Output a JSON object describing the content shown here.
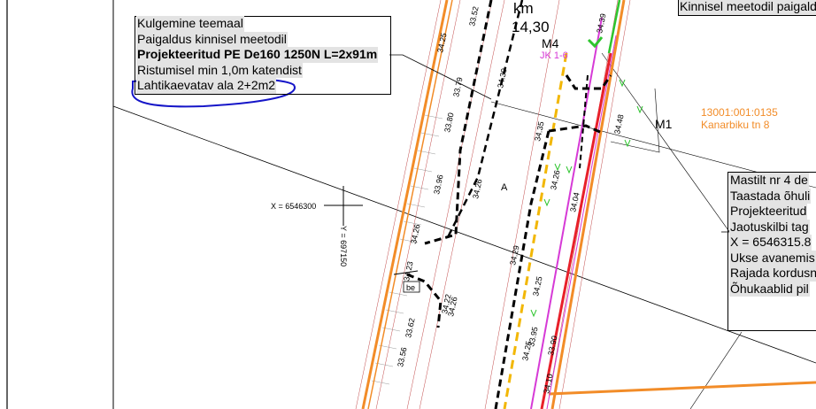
{
  "plan": {
    "top_right_note": "Kinnisel meetodil paigaldus",
    "km_label": "km",
    "km_value": "14,30",
    "station_m4": "M4",
    "station_m1": "M1",
    "jk_label": "JK 1-6",
    "parcel": {
      "id": "13001:001:0135",
      "address": "Kanarbiku tn 8"
    },
    "coord_x": "X = 6546300",
    "coord_y": "Y = 697150",
    "road_letter": "A",
    "building_label": "be",
    "elevations": [
      "33.52",
      "34.25",
      "33.79",
      "34.30",
      "33.80",
      "33.96",
      "34.26",
      "34.26",
      "34.23",
      "33.62",
      "34.22",
      "33.56",
      "34.26",
      "34.35",
      "34.26",
      "34.04",
      "34.29",
      "34.25",
      "33.95",
      "34.25",
      "33.90",
      "34.10",
      "34.39",
      "34.48"
    ],
    "colors": {
      "orange": "#f28c28",
      "yellow": "#f2b705",
      "red": "#e8202a",
      "magenta": "#d63ad6",
      "green": "#2ec52e",
      "blue_annotation": "#1515c8"
    }
  },
  "legend_left": {
    "lines": [
      "Kulgemine teemaal",
      "Paigaldus kinnisel meetodil",
      "Projekteeritud PE De160 1250N L=2x91m",
      "Ristumisel min 1,0m katendist",
      "Lahtikaevatav ala 2+2m2"
    ]
  },
  "legend_right": {
    "lines": [
      "Mastilt nr 4 de",
      "Taastada õhuli",
      "Projekteeritud",
      "Jaotuskilbi tag",
      "X = 6546315.8",
      "Ukse avanemis",
      "Rajada kordusn",
      "Õhukaablid pil"
    ]
  }
}
